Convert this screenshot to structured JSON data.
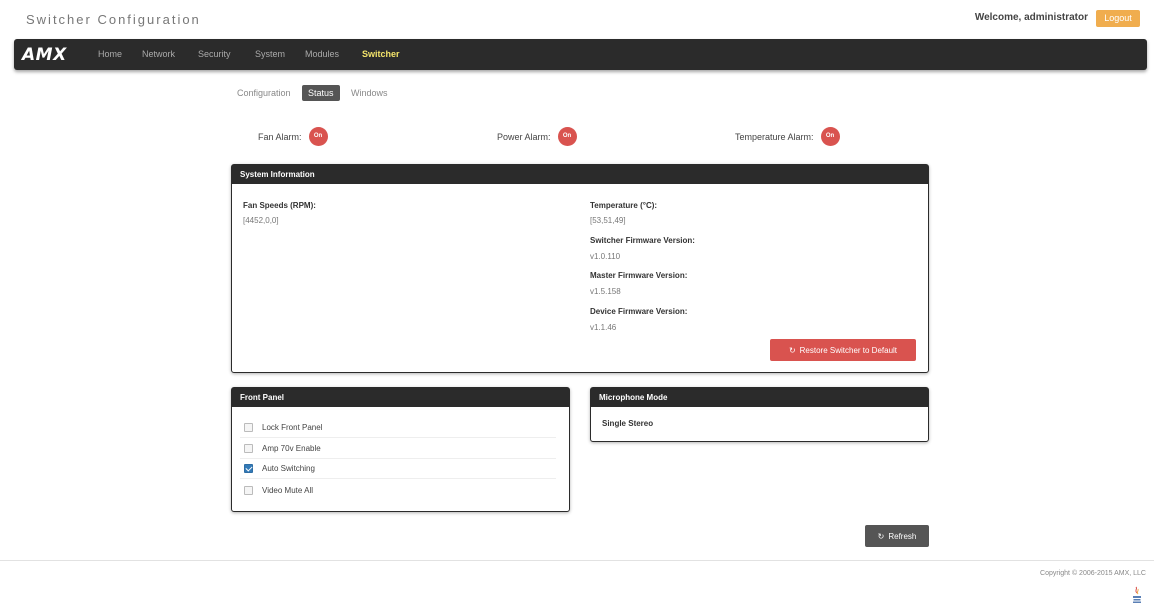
{
  "header": {
    "title": "Switcher Configuration",
    "welcome": "Welcome, administrator",
    "logout_label": "Logout"
  },
  "nav": {
    "logo": "AMX",
    "items": [
      "Home",
      "Network",
      "Security",
      "System",
      "Modules",
      "Switcher"
    ],
    "active": "Switcher"
  },
  "subtabs": [
    "Configuration",
    "Status",
    "Windows"
  ],
  "alarms": {
    "fan": {
      "label": "Fan Alarm:",
      "state": "On"
    },
    "power": {
      "label": "Power Alarm:",
      "state": "On"
    },
    "temperature": {
      "label": "Temperature Alarm:",
      "state": "On"
    }
  },
  "system_info": {
    "title": "System Information",
    "fan_speeds_label": "Fan Speeds (RPM):",
    "fan_speeds_value": "[4452,0,0]",
    "temperature_label": "Temperature (°C):",
    "temperature_value": "[53,51,49]",
    "switcher_fw_label": "Switcher Firmware Version:",
    "switcher_fw_value": "v1.0.110",
    "master_fw_label": "Master Firmware Version:",
    "master_fw_value": "v1.5.158",
    "device_fw_label": "Device Firmware Version:",
    "device_fw_value": "v1.1.46",
    "restore_label": "Restore Switcher to Default"
  },
  "front_panel": {
    "title": "Front Panel",
    "items": [
      {
        "label": "Lock Front Panel",
        "checked": false
      },
      {
        "label": "Amp 70v Enable",
        "checked": false
      },
      {
        "label": "Auto Switching",
        "checked": true
      },
      {
        "label": "Video Mute All",
        "checked": false
      }
    ]
  },
  "microphone": {
    "title": "Microphone Mode",
    "value": "Single Stereo"
  },
  "refresh_label": "Refresh",
  "footer": {
    "copyright": "Copyright © 2006-2015 AMX, LLC"
  },
  "colors": {
    "navbar": "#2b2b2b",
    "active_nav": "#f5e56b",
    "alarm": "#d9534f",
    "logout": "#f0ad4e",
    "checkbox_on": "#337ab7"
  }
}
